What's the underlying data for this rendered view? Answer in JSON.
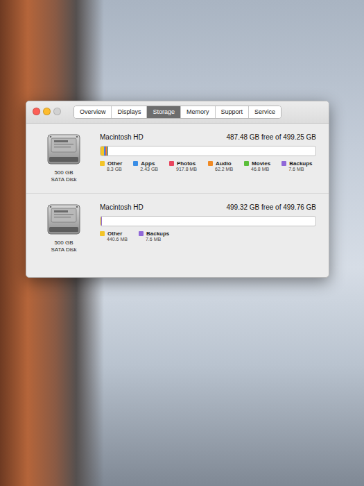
{
  "window": {
    "controls": [
      {
        "name": "close",
        "color": "#fc5f57",
        "disabled": false
      },
      {
        "name": "minimize",
        "color": "#fdbc2e",
        "disabled": false
      },
      {
        "name": "zoom",
        "color": "#cdcdcd",
        "disabled": true
      }
    ]
  },
  "tabs": [
    {
      "label": "Overview",
      "selected": false
    },
    {
      "label": "Displays",
      "selected": false
    },
    {
      "label": "Storage",
      "selected": true
    },
    {
      "label": "Memory",
      "selected": false
    },
    {
      "label": "Support",
      "selected": false
    },
    {
      "label": "Service",
      "selected": false
    }
  ],
  "disks": [
    {
      "name": "Macintosh HD",
      "free": "487.48 GB free of 499.25 GB",
      "capacity": "500 GB",
      "type": "SATA Disk",
      "categories": [
        {
          "label": "Other",
          "size": "8.3 GB",
          "level": 0.0166,
          "color": "#f3c428"
        },
        {
          "label": "Apps",
          "size": "2.43 GB",
          "level": 0.0049,
          "color": "#3a8ee6"
        },
        {
          "label": "Photos",
          "size": "917.8 MB",
          "level": 0.0018,
          "color": "#e8455e"
        },
        {
          "label": "Audio",
          "size": "62.2 MB",
          "level": 0.0001,
          "color": "#f08a24"
        },
        {
          "label": "Movies",
          "size": "46.8 MB",
          "level": 0.0001,
          "color": "#5bbf3a"
        },
        {
          "label": "Backups",
          "size": "7.6 MB",
          "level": 2e-05,
          "color": "#9068d8"
        }
      ]
    },
    {
      "name": "Macintosh HD",
      "free": "499.32 GB free of 499.76 GB",
      "capacity": "500 GB",
      "type": "SATA Disk",
      "categories": [
        {
          "label": "Other",
          "size": "440.6 MB",
          "level": 0.0009,
          "color": "#f3c428"
        },
        {
          "label": "Backups",
          "size": "7.6 MB",
          "level": 2e-05,
          "color": "#9068d8"
        }
      ]
    }
  ]
}
